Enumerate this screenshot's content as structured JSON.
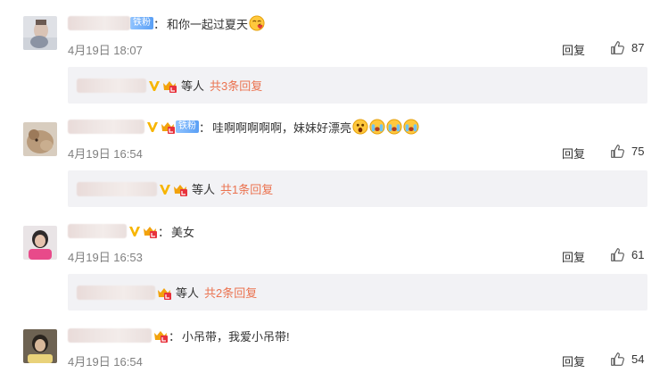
{
  "comments": [
    {
      "fan_badge": "铁粉",
      "separator": "：",
      "text": "和你一起过夏天",
      "time": "4月19日 18:07",
      "reply_label": "回复",
      "likes": "87",
      "reply_summary": {
        "deng": "等人",
        "count_text": "共3条回复"
      }
    },
    {
      "fan_badge": "铁粉",
      "separator": "：",
      "text": "哇啊啊啊啊啊，妹妹好漂亮",
      "time": "4月19日 16:54",
      "reply_label": "回复",
      "likes": "75",
      "reply_summary": {
        "deng": "等人",
        "count_text": "共1条回复"
      }
    },
    {
      "separator": "：",
      "text": "美女",
      "time": "4月19日 16:53",
      "reply_label": "回复",
      "likes": "61",
      "reply_summary": {
        "deng": "等人",
        "count_text": "共2条回复"
      }
    },
    {
      "separator": "：",
      "text": "小吊带，我爱小吊带!",
      "time": "4月19日 16:54",
      "reply_label": "回复",
      "likes": "54"
    }
  ],
  "colors": {
    "accent": "#eb7350",
    "vip": "#f7b500",
    "muted": "#808080",
    "reply_bg": "#f2f2f5"
  },
  "icons": {
    "like": "thumbs-up-icon",
    "vip": "vip-v-icon",
    "crown": "crown-badge-icon"
  }
}
